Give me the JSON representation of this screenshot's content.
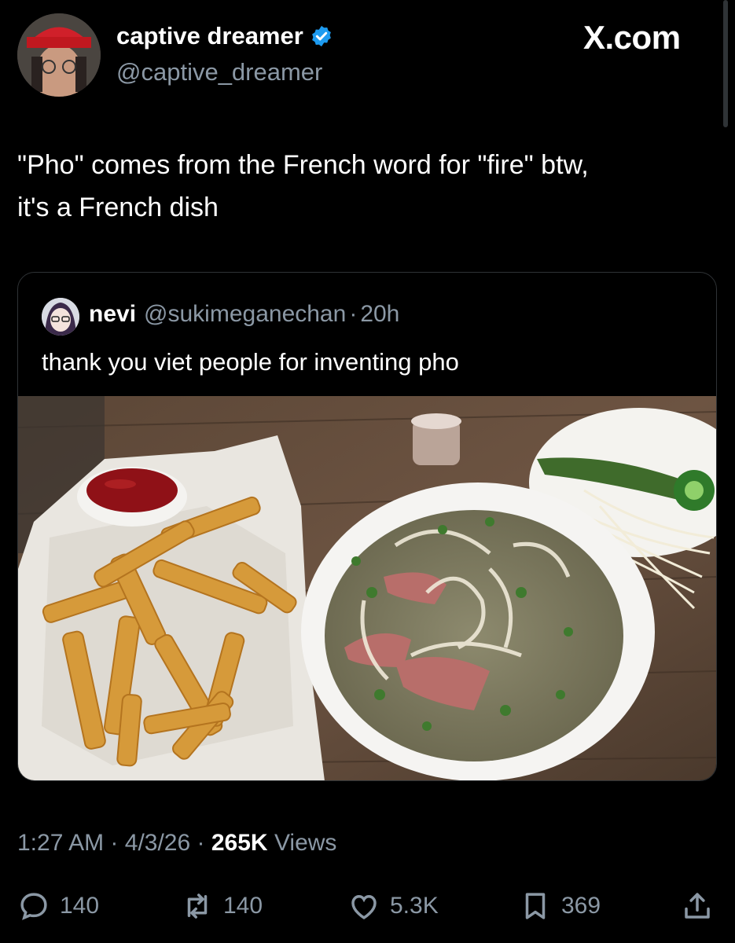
{
  "header": {
    "display_name": "captive dreamer",
    "handle": "@captive_dreamer",
    "watermark": "X.com",
    "verified_color": "#1d9bf0"
  },
  "tweet": {
    "text_line1": "\"Pho\" comes from the French word for \"fire\" btw,",
    "text_line2": "it's a French dish"
  },
  "quote": {
    "name": "nevi",
    "handle": "@sukimeganechan",
    "separator": "·",
    "age": "20h",
    "text": "thank you viet people for inventing pho",
    "photo_description_icon": "pho-and-fries-photo"
  },
  "meta": {
    "time": "1:27 AM",
    "sep1": "·",
    "date": "4/3/26",
    "sep2": "·",
    "views_count": "265K",
    "views_label": "Views"
  },
  "actions": {
    "replies": "140",
    "reposts": "140",
    "likes": "5.3K",
    "bookmarks": "369"
  }
}
